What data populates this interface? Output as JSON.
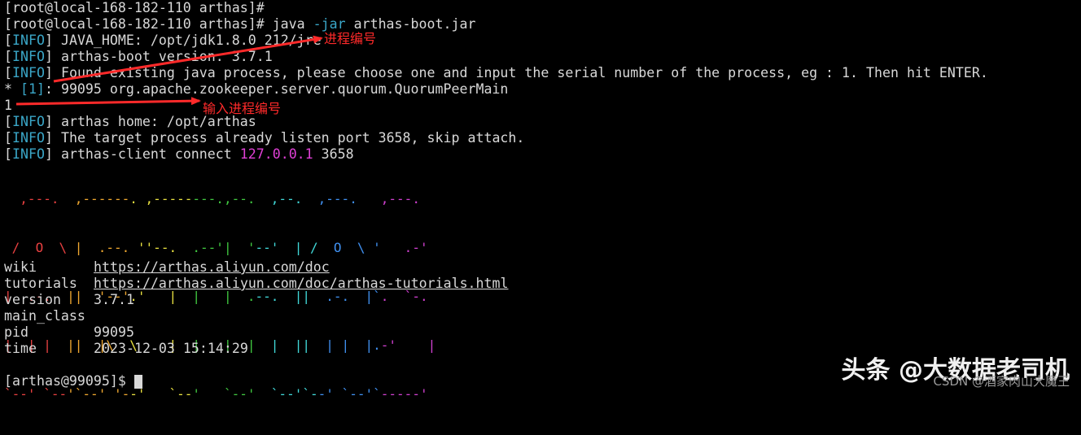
{
  "terminal": {
    "prompt_line": "[root@local-168-182-110 arthas]#",
    "command_line_prefix": "[root@local-168-182-110 arthas]# java ",
    "command_flag": "-jar",
    "command_rest": " arthas-boot.jar",
    "info_tag": "INFO",
    "java_home": " JAVA_HOME: /opt/jdk1.8.0_212/jre",
    "boot_version": " arthas-boot version: 3.7.1",
    "found_process": " Found existing java process, please choose one and input the serial number of the process, eg : 1. Then hit ENTER.",
    "process_prefix": "* ",
    "process_index": "[1]",
    "process_entry": ": 99095 org.apache.zookeeper.server.quorum.QuorumPeerMain",
    "user_input": "1",
    "arthas_home": " arthas home: /opt/arthas",
    "already_listen": " The target process already listen port 3658, skip attach.",
    "client_connect_prefix": " arthas-client connect ",
    "client_ip": "127.0.0.1",
    "client_port": " 3658",
    "final_prompt": "[arthas@99095]$"
  },
  "logo": {
    "colors": [
      "#e84040",
      "#f0a830",
      "#e8e040",
      "#40c840",
      "#40d8d8",
      "#4090f0",
      "#d040d0"
    ],
    "lines": [
      "  ,---.  ,------. ,--------.,--.  ,--.  ,---.   ,---.",
      " /  O  \\ |  .--. ''--.  .--'|  '--'  | /  O  \\ '   .-'",
      "|  .-.  ||  '--'.'   |  |   |  .--.  ||  .-.  |`.  `-.",
      "|  | |  ||  |\\  \\    |  |   |  |  |  ||  | |  |.-'    |",
      "`--' `--'`--' '--'   `--'   `--'  `--'`--' `--'`-----'"
    ]
  },
  "info": {
    "rows": [
      {
        "key": "wiki",
        "value": "https://arthas.aliyun.com/doc"
      },
      {
        "key": "tutorials",
        "value": "https://arthas.aliyun.com/doc/arthas-tutorials.html"
      },
      {
        "key": "version",
        "value": "3.7.1"
      },
      {
        "key": "main_class",
        "value": ""
      },
      {
        "key": "pid",
        "value": "99095"
      },
      {
        "key": "time",
        "value": "2023-12-03 15:14:29"
      }
    ]
  },
  "annotations": {
    "process_number": "进程编号",
    "input_process_number": "输入进程编号",
    "arrow_color": "#ff2a2a"
  },
  "watermark": {
    "main": "头条 @大数据老司机",
    "sub": "CSDN @酒家肉山大魔王"
  }
}
